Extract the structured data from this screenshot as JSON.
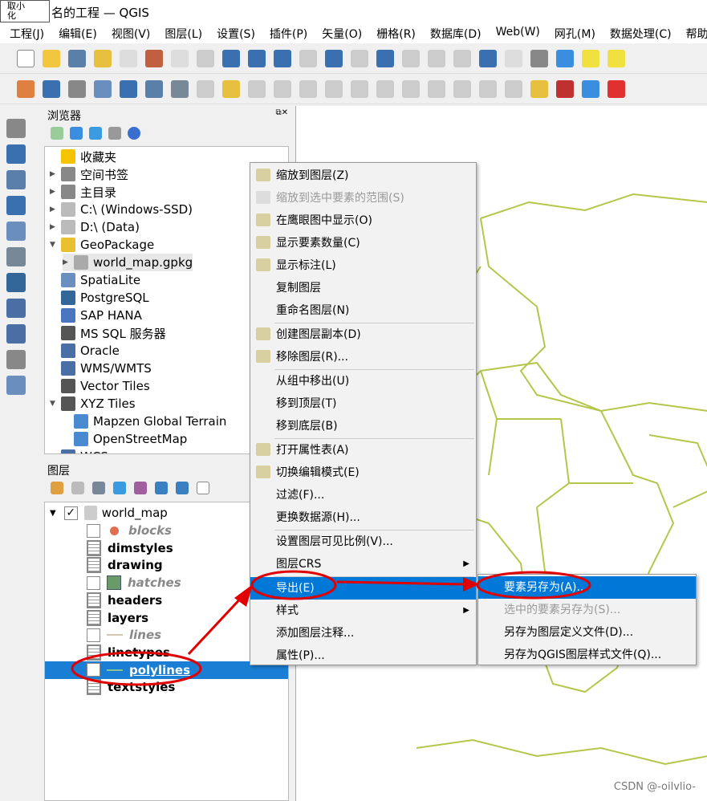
{
  "window": {
    "tooltip": "取小\n化",
    "title": "名的工程 — QGIS"
  },
  "menubar": [
    "工程(J)",
    "编辑(E)",
    "视图(V)",
    "图层(L)",
    "设置(S)",
    "插件(P)",
    "矢量(O)",
    "栅格(R)",
    "数据库(D)",
    "Web(W)",
    "网孔(M)",
    "数据处理(C)",
    "帮助("
  ],
  "browser": {
    "title": "浏览器",
    "items": [
      {
        "label": "收藏夹",
        "icon": "star-icon",
        "color": "#f5c400"
      },
      {
        "label": "空间书签",
        "icon": "bookmark-icon",
        "color": "#888"
      },
      {
        "label": "主目录",
        "icon": "home-icon",
        "color": "#888"
      },
      {
        "label": "C:\\ (Windows-SSD)",
        "icon": "folder-icon",
        "color": "#bbb"
      },
      {
        "label": "D:\\ (Data)",
        "icon": "folder-icon",
        "color": "#bbb"
      },
      {
        "label": "GeoPackage",
        "icon": "geopackage-icon",
        "color": "#e8c030"
      },
      {
        "label": "world_map.gpkg",
        "icon": "database-icon",
        "color": "#aaa"
      },
      {
        "label": "SpatiaLite",
        "icon": "feather-icon",
        "color": "#6a8fbf"
      },
      {
        "label": "PostgreSQL",
        "icon": "elephant-icon",
        "color": "#336699"
      },
      {
        "label": "SAP HANA",
        "icon": "hana-icon",
        "color": "#4a76c0"
      },
      {
        "label": "MS SQL 服务器",
        "icon": "mssql-icon",
        "color": "#555"
      },
      {
        "label": "Oracle",
        "icon": "oracle-icon",
        "color": "#4a6fa5"
      },
      {
        "label": "WMS/WMTS",
        "icon": "globe-icon",
        "color": "#4a6fa5"
      },
      {
        "label": "Vector Tiles",
        "icon": "grid-icon",
        "color": "#555"
      },
      {
        "label": "XYZ Tiles",
        "icon": "grid-icon",
        "color": "#555"
      },
      {
        "label": "Mapzen Global Terrain",
        "icon": "tiles-icon",
        "color": "#4a8ad0"
      },
      {
        "label": "OpenStreetMap",
        "icon": "tiles-icon",
        "color": "#4a8ad0"
      },
      {
        "label": "WCS",
        "icon": "globe-icon",
        "color": "#4a6fa5"
      }
    ]
  },
  "layers": {
    "title": "图层",
    "group": "world_map",
    "items": [
      {
        "label": "blocks",
        "checked": false,
        "style": "italic-gray",
        "icon": "point-icon"
      },
      {
        "label": "dimstyles",
        "style": "bold",
        "icon": "table-icon"
      },
      {
        "label": "drawing",
        "style": "bold",
        "icon": "table-icon"
      },
      {
        "label": "hatches",
        "checked": false,
        "style": "italic-gray",
        "icon": "polygon-icon"
      },
      {
        "label": "headers",
        "style": "bold",
        "icon": "table-icon"
      },
      {
        "label": "layers",
        "style": "bold",
        "icon": "table-icon"
      },
      {
        "label": "lines",
        "checked": false,
        "style": "italic-gray",
        "icon": "line-icon"
      },
      {
        "label": "linetypes",
        "style": "bold",
        "icon": "table-icon"
      },
      {
        "label": "polylines",
        "checked": true,
        "style": "selected",
        "icon": "line-icon"
      },
      {
        "label": "textstyles",
        "style": "bold",
        "icon": "table-icon"
      }
    ]
  },
  "context_menu": [
    {
      "label": "缩放到图层(Z)",
      "icon": "zoom-layer-icon"
    },
    {
      "label": "缩放到选中要素的范围(S)",
      "disabled": true,
      "icon": "zoom-selection-icon"
    },
    {
      "label": "在鹰眼图中显示(O)",
      "icon": "glasses-icon"
    },
    {
      "label": "显示要素数量(C)",
      "icon": "checkbox-icon"
    },
    {
      "label": "显示标注(L)",
      "icon": "label-icon"
    },
    {
      "label": "复制图层"
    },
    {
      "label": "重命名图层(N)",
      "sep_after": true
    },
    {
      "label": "创建图层副本(D)",
      "icon": "duplicate-icon"
    },
    {
      "label": "移除图层(R)...",
      "icon": "remove-icon",
      "sep_after": true
    },
    {
      "label": "从组中移出(U)"
    },
    {
      "label": "移到顶层(T)"
    },
    {
      "label": "移到底层(B)",
      "sep_after": true
    },
    {
      "label": "打开属性表(A)",
      "icon": "table-icon"
    },
    {
      "label": "切换编辑模式(E)",
      "icon": "pencil-icon"
    },
    {
      "label": "过滤(F)..."
    },
    {
      "label": "更换数据源(H)...",
      "sep_after": true
    },
    {
      "label": "设置图层可见比例(V)..."
    },
    {
      "label": "图层CRS",
      "submenu": true,
      "sep_after": true
    },
    {
      "label": "导出(E)",
      "submenu": true,
      "highlighted": true
    },
    {
      "label": "样式",
      "submenu": true
    },
    {
      "label": "添加图层注释..."
    },
    {
      "label": "属性(P)..."
    }
  ],
  "export_submenu": [
    {
      "label": "要素另存为(A)...",
      "highlighted": true
    },
    {
      "label": "选中的要素另存为(S)...",
      "disabled": true
    },
    {
      "label": "另存为图层定义文件(D)..."
    },
    {
      "label": "另存为QGIS图层样式文件(Q)..."
    }
  ],
  "watermark": "CSDN @-oilvlio-",
  "colors": {
    "highlight": "#0078d7",
    "map_lines": "#b5c64a",
    "annotation": "#e00000"
  }
}
